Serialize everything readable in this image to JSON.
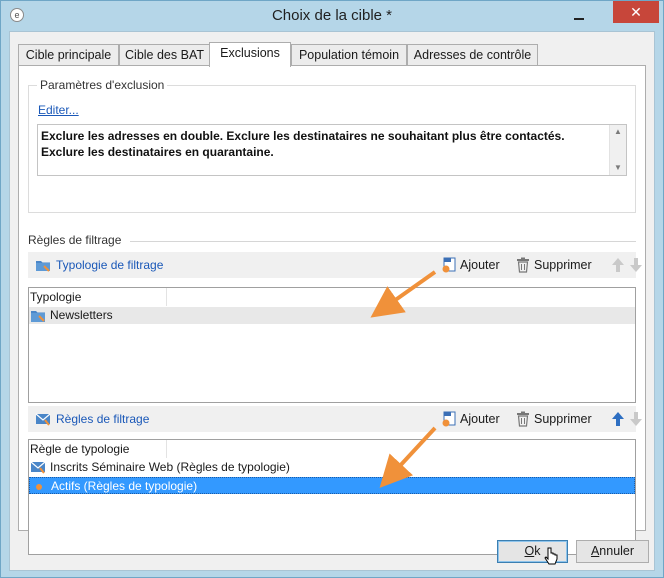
{
  "window": {
    "title": "Choix de la cible *",
    "close_glyph": "✕"
  },
  "tabs": [
    {
      "label": "Cible principale"
    },
    {
      "label": "Cible des BAT"
    },
    {
      "label": "Exclusions",
      "active": true
    },
    {
      "label": "Population témoin"
    },
    {
      "label": "Adresses de contrôle"
    }
  ],
  "exclusion": {
    "group_label": "Paramètres d'exclusion",
    "edit_link": "Editer...",
    "text": "Exclure les adresses en double. Exclure les destinataires ne souhaitant plus être contactés. Exclure les destinataires en quarantaine."
  },
  "filter_rules": {
    "section_label": "Règles de filtrage",
    "typology_toolbar": {
      "title": "Typologie de filtrage",
      "add_label": "Ajouter",
      "delete_label": "Supprimer"
    },
    "typology_list": {
      "column": "Typologie",
      "rows": [
        {
          "label": "Newsletters"
        }
      ]
    },
    "rules_toolbar": {
      "title": "Règles de filtrage",
      "add_label": "Ajouter",
      "delete_label": "Supprimer"
    },
    "rules_list": {
      "column": "Règle de typologie",
      "rows": [
        {
          "label": "Inscrits Séminaire Web (Règles de typologie)"
        },
        {
          "label": "Actifs (Règles de typologie)",
          "selected": true
        }
      ]
    }
  },
  "buttons": {
    "ok": {
      "accel": "O",
      "rest": "k"
    },
    "cancel": {
      "accel": "A",
      "rest": "nnuler"
    }
  },
  "colors": {
    "accent_link": "#1a58b8",
    "selection": "#3399ff",
    "annotation_arrow": "#f0913a",
    "close_button": "#c7463a"
  }
}
